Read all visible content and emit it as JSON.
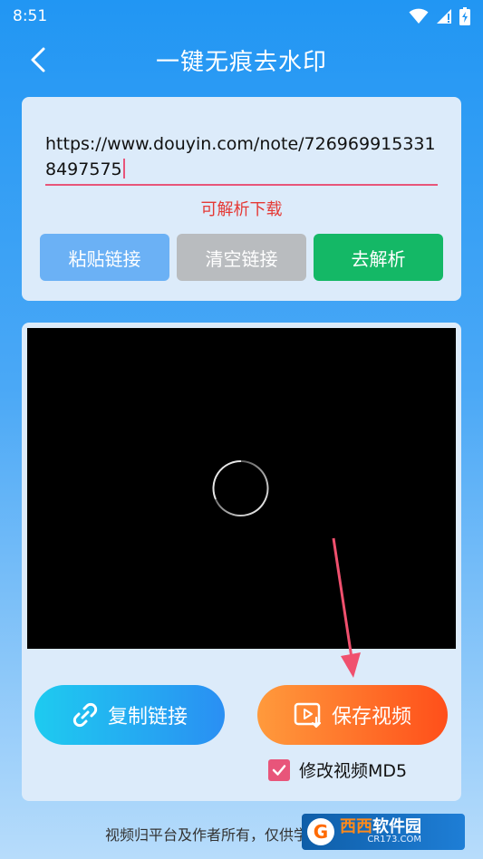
{
  "status_bar": {
    "time": "8:51"
  },
  "app_bar": {
    "title": "一键无痕去水印"
  },
  "input": {
    "url_value": "https://www.douyin.com/note/7269699153318497575"
  },
  "parse_status": "可解析下载",
  "buttons": {
    "paste": "粘贴链接",
    "clear": "清空链接",
    "parse": "去解析"
  },
  "actions": {
    "copy_link": "复制链接",
    "save_video": "保存视频",
    "md5_label": "修改视频MD5",
    "md5_checked": true
  },
  "footer": {
    "text": "视频归平台及作者所有，仅供学"
  },
  "watermark": {
    "logo": "G",
    "main_a": "西西",
    "main_b": "软件园",
    "sub": "CR173.COM"
  },
  "colors": {
    "accent_blue": "#2196f3",
    "parse_green": "#14b866",
    "save_orange": "#ff4f1a",
    "checkbox_pink": "#e8557a",
    "status_red": "#e53935"
  }
}
